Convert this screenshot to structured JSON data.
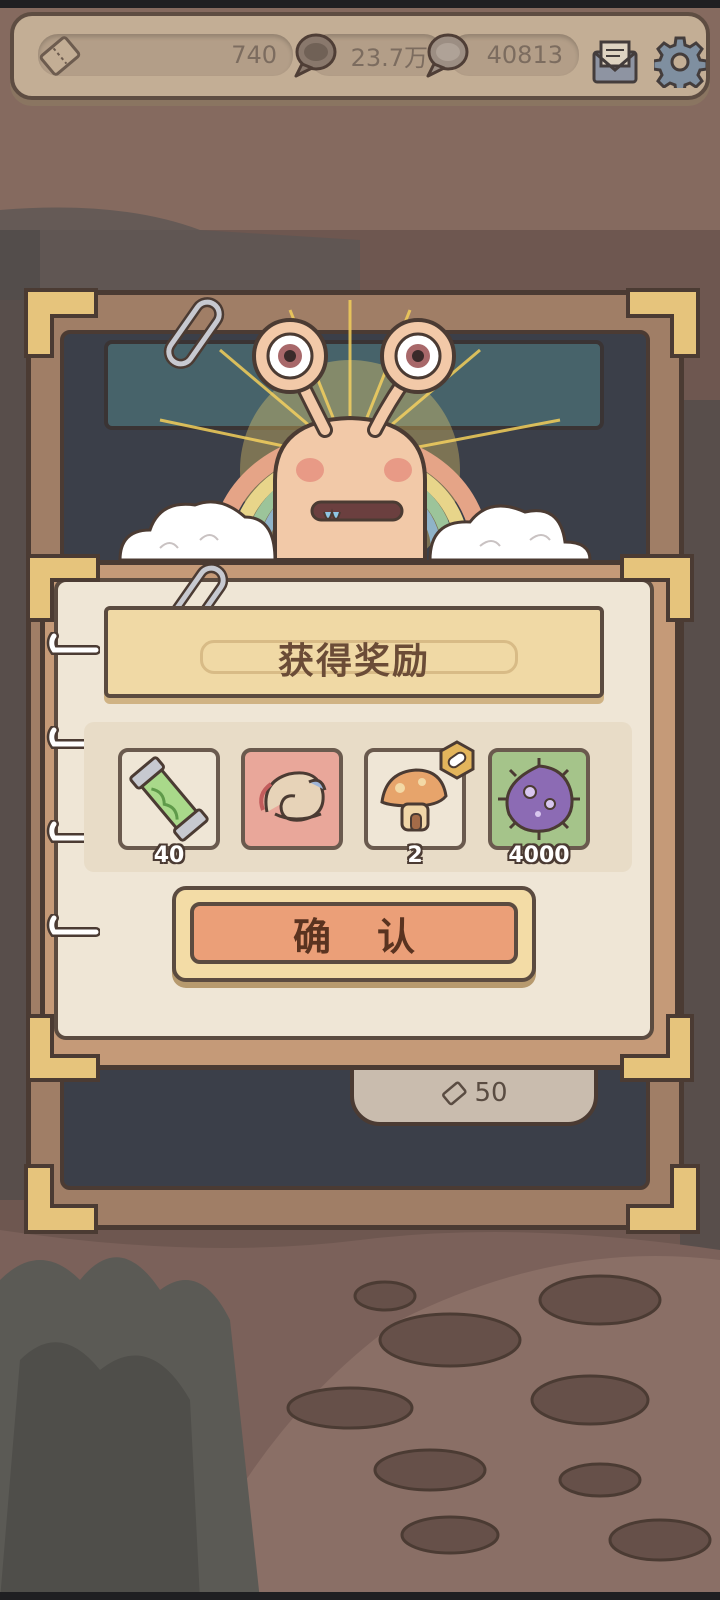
{
  "top_bar": {
    "ticket_value": "740",
    "coin_value": "23.7万",
    "gem_value": "40813",
    "icons": [
      "ticket-icon",
      "bubble-coin-icon",
      "bubble-gem-icon",
      "mail-icon",
      "gear-icon"
    ]
  },
  "reward_dialog": {
    "title": "获得奖励",
    "rewards": [
      {
        "icon": "green-capsule-icon",
        "count": "40",
        "bg": "#efe6d6"
      },
      {
        "icon": "snail-shell-icon",
        "count": "",
        "bg": "#e9a79a"
      },
      {
        "icon": "mushroom-house-icon",
        "count": "2",
        "bg": "#efe6d6"
      },
      {
        "icon": "purple-virus-icon",
        "count": "4000",
        "bg": "#a5c48a"
      }
    ],
    "confirm_label": "确认"
  },
  "background_panel": {
    "price_value": "50"
  },
  "colors": {
    "paper": "#efe6d6",
    "title_plate": "#f0d9a5",
    "confirm_button": "#eb9f78",
    "frame_dark": "#4b3b33"
  }
}
